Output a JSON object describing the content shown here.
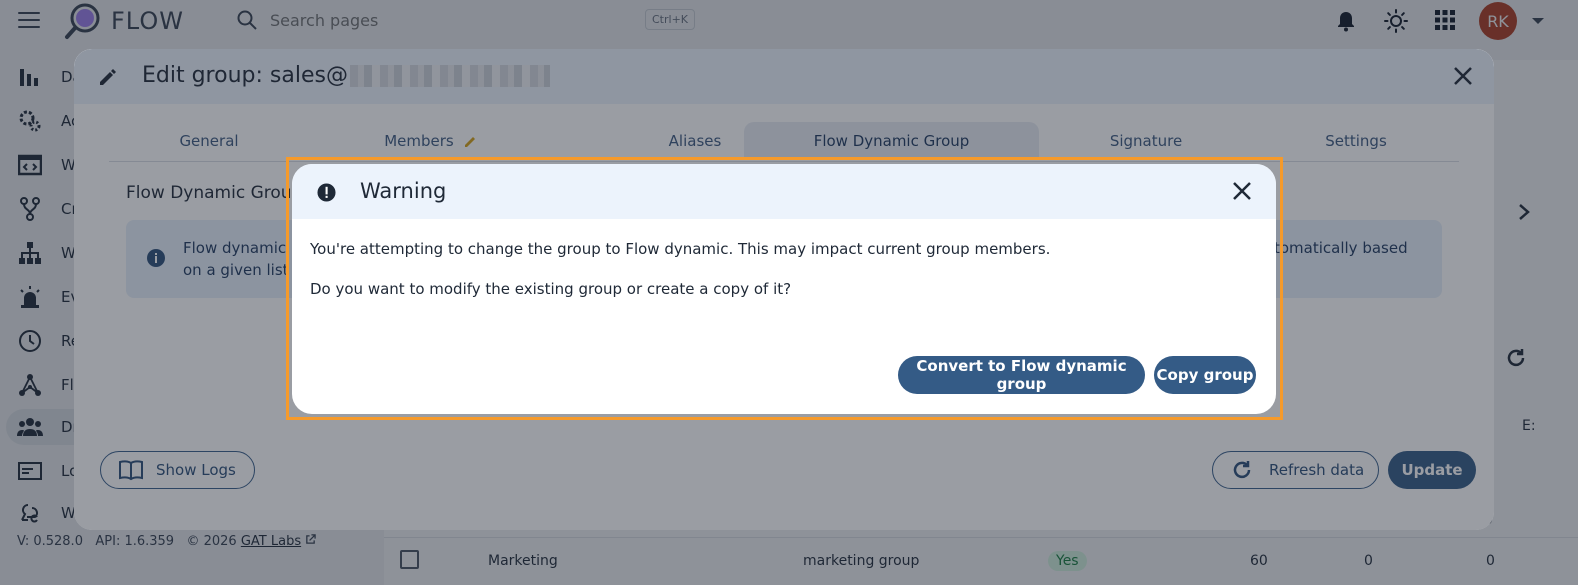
{
  "app": {
    "brand": "FLOW",
    "search_placeholder": "Search pages",
    "search_shortcut": "Ctrl+K",
    "avatar_initials": "RK"
  },
  "sidebar": {
    "items": [
      {
        "label": "Da",
        "icon": "bar-chart-icon"
      },
      {
        "label": "Ac",
        "icon": "gears-icon"
      },
      {
        "label": "W",
        "icon": "window-code-icon"
      },
      {
        "label": "Cr",
        "icon": "fork-icon"
      },
      {
        "label": "W",
        "icon": "org-tree-icon"
      },
      {
        "label": "Ev",
        "icon": "alarm-light-icon"
      },
      {
        "label": "Re",
        "icon": "clock-icon"
      },
      {
        "label": "Fl",
        "icon": "flow-graph-icon"
      },
      {
        "label": "Dr",
        "icon": "groups-icon"
      },
      {
        "label": "Lo",
        "icon": "card-icon"
      },
      {
        "label": "W",
        "icon": "webhook-icon"
      }
    ],
    "footer_version": "V: 0.528.0",
    "footer_api": "API: 1.6.359",
    "footer_copyright": "© 2026",
    "footer_link": "GAT Labs"
  },
  "background_table": {
    "row": {
      "name": "Marketing",
      "description": "marketing group",
      "flag": "Yes",
      "count": "60",
      "col_a": "0",
      "col_b": "0"
    },
    "partial_header": "E:",
    "partial_cell": "0"
  },
  "edit_dialog": {
    "title": "Edit group: sales@",
    "tabs": [
      "General",
      "Members",
      "Aliases",
      "Flow Dynamic Group",
      "Signature",
      "Settings"
    ],
    "active_tab": "Flow Dynamic Group",
    "section_title": "Flow Dynamic Grou",
    "info_left_line1": "Flow dynamic",
    "info_left_line2": "on a given list",
    "info_right_line1": "tomatically based",
    "show_logs_label": "Show Logs",
    "refresh_label": "Refresh data",
    "update_label": "Update"
  },
  "warning_dialog": {
    "title": "Warning",
    "message_1": "You're attempting to change the group to Flow dynamic. This may impact current group members.",
    "message_2": "Do you want to modify the existing group or create a copy of it?",
    "convert_label": "Convert to Flow dynamic group",
    "copy_label": "Copy group"
  },
  "colors": {
    "primary": "#345b86",
    "highlight": "#f59a2b",
    "header_bg": "#ecf3fc"
  }
}
